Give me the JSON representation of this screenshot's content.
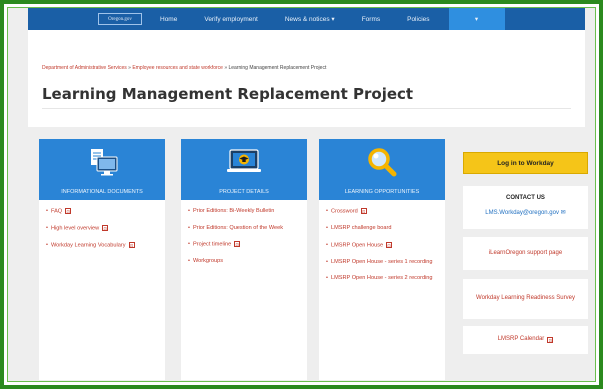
{
  "nav": {
    "logo_text": "Oregon.gov",
    "items": [
      "Home",
      "Verify employment",
      "News & notices ▾",
      "Forms",
      "Policies"
    ],
    "active_item": "▾"
  },
  "breadcrumb": {
    "items": [
      "Department of Administrative Services",
      "Employee resources and state workforce"
    ],
    "separator": "»",
    "current": "Learning Management Replacement Project"
  },
  "page_title": "Learning Management Replacement Project",
  "cards": [
    {
      "icon": "document-monitor-icon",
      "caption": "INFORMATIONAL DOCUMENTS",
      "links": [
        "FAQ",
        "High level overview",
        "Workday Learning Vocabulary"
      ],
      "pdf": [
        true,
        true,
        true
      ]
    },
    {
      "icon": "graduation-laptop-icon",
      "caption": "PROJECT DETAILS",
      "links": [
        "Prior Editions: Bi-Weekly Bulletin",
        "Prior Editions: Question of the Week",
        "Project timeline",
        "Workgroups"
      ],
      "pdf": [
        false,
        false,
        true,
        false
      ]
    },
    {
      "icon": "magnifier-icon",
      "caption": "LEARNING OPPORTUNITIES",
      "links": [
        "Crossword",
        "LMSRP challenge board",
        "LMSRP Open House",
        "LMSRP Open House - series 1 recording",
        "LMSRP Open House - series 2 recording"
      ],
      "pdf": [
        true,
        false,
        true,
        false,
        false
      ]
    }
  ],
  "sidebar": {
    "login_label": "Log in to Workday",
    "contact_title": "CONTACT US",
    "contact_email": "LMS.Workday@oregon.gov ✉",
    "links": [
      "iLearnOregon support page",
      "Workday Learning Readiness Survey",
      "LMSRP Calendar"
    ],
    "pdf_symbol": "⊡"
  },
  "colors": {
    "nav_bg": "#1a5fa6",
    "card_head": "#2a84d6",
    "link": "#c0392b",
    "button": "#f5c518",
    "frame": "#2b8a1e"
  }
}
